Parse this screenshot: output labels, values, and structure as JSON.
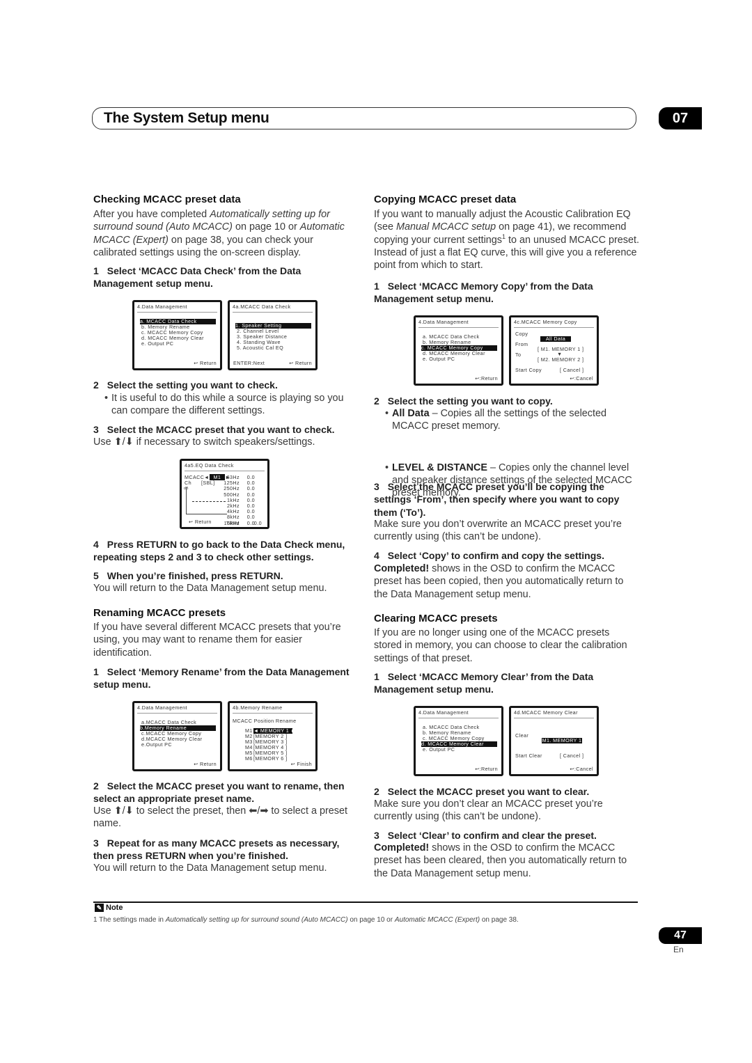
{
  "header": {
    "title": "The System Setup menu",
    "chapter": "07"
  },
  "left": [
    {
      "kind": "h",
      "text": "Checking MCACC preset data"
    },
    {
      "kind": "p",
      "segs": [
        {
          "t": "After you have completed "
        },
        {
          "t": "Automatically setting up for surround sound (Auto MCACC)",
          "st": "i"
        },
        {
          "t": " on page 10 or "
        },
        {
          "t": "Automatic MCACC (Expert)",
          "st": "i"
        },
        {
          "t": " on page 38, you can check your calibrated settings using the on-screen display."
        }
      ]
    },
    {
      "kind": "step",
      "num": "1",
      "text": "Select ‘MCACC Data Check’ from the Data Management setup menu."
    },
    {
      "kind": "osd",
      "panels": [
        {
          "type": "menu",
          "title": "4.Data Management",
          "items": [
            "a. MCACC Data Check",
            "b. Memory Rename",
            "c. MCACC Memory Copy",
            "d. MCACC Memory Clear",
            "e. Output PC"
          ],
          "sel": 0,
          "footer": "↩ Return"
        },
        {
          "type": "menu",
          "title": "4a.MCACC Data Check",
          "items": [
            "1. Speaker Setting",
            "2. Channel Level",
            "3. Speaker Distance",
            "4. Standing Wave",
            "5. Acoustic Cal EQ"
          ],
          "sel": 0,
          "footer_left": "ENTER:Next",
          "footer": "↩ Return",
          "offset": 1
        }
      ]
    },
    {
      "kind": "step",
      "num": "2",
      "text": "Select the setting you want to check."
    },
    {
      "kind": "bullet",
      "segs": [
        {
          "t": "It is useful to do this while a source is playing so you can compare the different settings."
        }
      ]
    },
    {
      "kind": "step",
      "num": "3",
      "text": "Select the MCACC preset that you want to check."
    },
    {
      "kind": "p",
      "segs": [
        {
          "t": "Use ⬆/⬇ if necessary to switch speakers/settings."
        }
      ]
    },
    {
      "kind": "osd",
      "panels": [
        {
          "type": "eq",
          "title": "4a5.EQ Data Check",
          "mcacc_label": "MCACC",
          "mcacc_value": "M1",
          "ch_label": "Ch",
          "ch_value": "[SBL]",
          "axis_label": "dB",
          "bands": [
            [
              "63Hz",
              "0.0"
            ],
            [
              "125Hz",
              "0.0"
            ],
            [
              "250Hz",
              "0.0"
            ],
            [
              "500Hz",
              "0.0"
            ],
            [
              "1kHz",
              "0.0"
            ],
            [
              "2kHz",
              "0.0"
            ],
            [
              "4kHz",
              "0.0"
            ],
            [
              "8kHz",
              "0.0"
            ],
            [
              "16kHz",
              "0.0"
            ]
          ],
          "trim_label": "TRIM",
          "trim_value": "0.0",
          "footer": "↩ Return"
        }
      ]
    },
    {
      "kind": "step",
      "num": "4",
      "text": "Press RETURN to go back to the Data Check menu, repeating steps 2 and 3 to check other settings."
    },
    {
      "kind": "step",
      "num": "5",
      "text": "When you’re finished, press RETURN."
    },
    {
      "kind": "p",
      "segs": [
        {
          "t": "You will return to the Data Management setup menu."
        }
      ]
    },
    {
      "kind": "h",
      "text": "Renaming MCACC presets"
    },
    {
      "kind": "p",
      "segs": [
        {
          "t": "If you have several different MCACC presets that you’re using, you may want to rename them for easier identification."
        }
      ]
    },
    {
      "kind": "step",
      "num": "1",
      "text": "Select ‘Memory Rename’ from the Data Management setup menu."
    },
    {
      "kind": "osd",
      "panels": [
        {
          "type": "menu",
          "title": "4.Data Management",
          "items": [
            "a.MCACC Data Check",
            "b.Memory Rename",
            "c.MCACC Memory Copy",
            "d.MCACC Memory Clear",
            "e.Output PC"
          ],
          "sel": 1,
          "footer": "↩ Return"
        },
        {
          "type": "rename",
          "title": "4b.Memory Rename",
          "subtitle": "MCACC Position Rename",
          "rows": [
            [
              "M1",
              "◄ MEMORY 1 ►"
            ],
            [
              "M2",
              "[MEMORY 2 ]"
            ],
            [
              "M3",
              "[MEMORY 3 ]"
            ],
            [
              "M4",
              "[MEMORY 4 ]"
            ],
            [
              "M5",
              "[MEMORY 5 ]"
            ],
            [
              "M6",
              "[MEMORY 6 ]"
            ]
          ],
          "sel": 0,
          "footer": "↩ Finish"
        }
      ]
    },
    {
      "kind": "step",
      "num": "2",
      "text": "Select the MCACC preset you want to rename, then select an appropriate preset name."
    },
    {
      "kind": "p",
      "segs": [
        {
          "t": "Use ⬆/⬇ to select the preset, then ⬅/➡ to select a preset name."
        }
      ]
    },
    {
      "kind": "step",
      "num": "3",
      "text": "Repeat for as many MCACC presets as necessary, then press RETURN when you’re finished."
    },
    {
      "kind": "p",
      "segs": [
        {
          "t": "You will return to the Data Management setup menu."
        }
      ]
    }
  ],
  "right": [
    {
      "kind": "h",
      "text": "Copying MCACC preset data"
    },
    {
      "kind": "p",
      "segs": [
        {
          "t": "If you want to manually adjust the Acoustic Calibration EQ (see "
        },
        {
          "t": "Manual MCACC setup",
          "st": "i"
        },
        {
          "t": " on page 41), we recommend copying your current settings"
        },
        {
          "t": "1",
          "st": "sup"
        },
        {
          "t": " to an unused MCACC preset. Instead of just a flat EQ curve, this will give you a reference point from which to start."
        }
      ]
    },
    {
      "kind": "step",
      "num": "1",
      "text": "Select ‘MCACC Memory Copy’ from the Data Management setup menu."
    },
    {
      "kind": "osd",
      "panels": [
        {
          "type": "menu",
          "title": "4.Data Management",
          "items": [
            "a. MCACC Data Check",
            "b. Memory Rename",
            "c. MCACC Memory Copy",
            "d. MCACC Memory Clear",
            "e. Output PC"
          ],
          "sel": 2,
          "footer": "↩:Return"
        },
        {
          "type": "copy",
          "title": "4c.MCACC Memory Copy",
          "copy_label": "Copy",
          "copy_value": "All Data",
          "from_label": "From",
          "from_value": "[ M1. MEMORY 1 ]",
          "to_label": "To",
          "to_value": "[ M2. MEMORY 2 ]",
          "start_label": "Start Copy",
          "start_value": "[ Cancel ]",
          "footer": "↩:Cancel"
        }
      ]
    },
    {
      "kind": "step",
      "num": "2",
      "text": "Select the setting you want to copy."
    },
    {
      "kind": "bullet",
      "segs": [
        {
          "t": "All Data",
          "st": "b"
        },
        {
          "t": " – Copies all the settings of the selected MCACC preset memory."
        }
      ]
    },
    {
      "kind": "bullet",
      "segs": [
        {
          "t": "LEVEL & DISTANCE",
          "st": "b"
        },
        {
          "t": " – Copies only the channel level and speaker distance settings of the selected MCACC preset memory."
        }
      ]
    },
    {
      "kind": "step",
      "num": "3",
      "text": "Select the MCACC preset you’ll be copying the settings ‘From’, then specify where you want to copy them (‘To’)."
    },
    {
      "kind": "p",
      "segs": [
        {
          "t": "Make sure you don’t overwrite an MCACC preset you’re currently using (this can’t be undone)."
        }
      ]
    },
    {
      "kind": "step",
      "num": "4",
      "text": "Select ‘Copy’ to confirm and copy the settings."
    },
    {
      "kind": "p",
      "segs": [
        {
          "t": "Completed!",
          "st": "b"
        },
        {
          "t": " shows in the OSD to confirm the MCACC preset has been copied, then you automatically return to the Data Management setup menu."
        }
      ]
    },
    {
      "kind": "h",
      "text": "Clearing MCACC presets"
    },
    {
      "kind": "p",
      "segs": [
        {
          "t": "If you are no longer using one of the MCACC presets stored in memory, you can choose to clear the calibration settings of that preset."
        }
      ]
    },
    {
      "kind": "step",
      "num": "1",
      "text": "Select ‘MCACC Memory Clear’ from the Data Management setup menu."
    },
    {
      "kind": "osd",
      "panels": [
        {
          "type": "menu",
          "title": "4.Data Management",
          "items": [
            "a. MCACC Data Check",
            "b. Memory Rename",
            "c. MCACC Memory Copy",
            "d. MCACC Memory Clear",
            "e. Output PC"
          ],
          "sel": 3,
          "footer": "↩:Return"
        },
        {
          "type": "clear",
          "title": "4d.MCACC Memory Clear",
          "clear_label": "Clear",
          "clear_value": "M1. MEMORY 1",
          "start_label": "Start Clear",
          "start_value": "[ Cancel ]",
          "footer": "↩:Cancel"
        }
      ]
    },
    {
      "kind": "step",
      "num": "2",
      "text": "Select the MCACC preset you want to clear."
    },
    {
      "kind": "p",
      "segs": [
        {
          "t": "Make sure you don’t clear an MCACC preset you’re currently using (this can’t be undone)."
        }
      ]
    },
    {
      "kind": "step",
      "num": "3",
      "text": "Select ‘Clear’ to confirm and clear the preset."
    },
    {
      "kind": "p",
      "segs": [
        {
          "t": "Completed!",
          "st": "b"
        },
        {
          "t": " shows in the OSD to confirm the MCACC preset has been cleared, then you automatically return to the Data Management setup menu."
        }
      ]
    }
  ],
  "note": {
    "heading": "Note",
    "icon": "pencil-icon",
    "segs": [
      {
        "t": "1 The settings made in "
      },
      {
        "t": "Automatically setting up for surround sound (Auto MCACC)",
        "st": "i"
      },
      {
        "t": " on page 10 or "
      },
      {
        "t": "Automatic MCACC (Expert)",
        "st": "i"
      },
      {
        "t": " on page 38."
      }
    ]
  },
  "footer": {
    "page": "47",
    "lang": "En"
  }
}
